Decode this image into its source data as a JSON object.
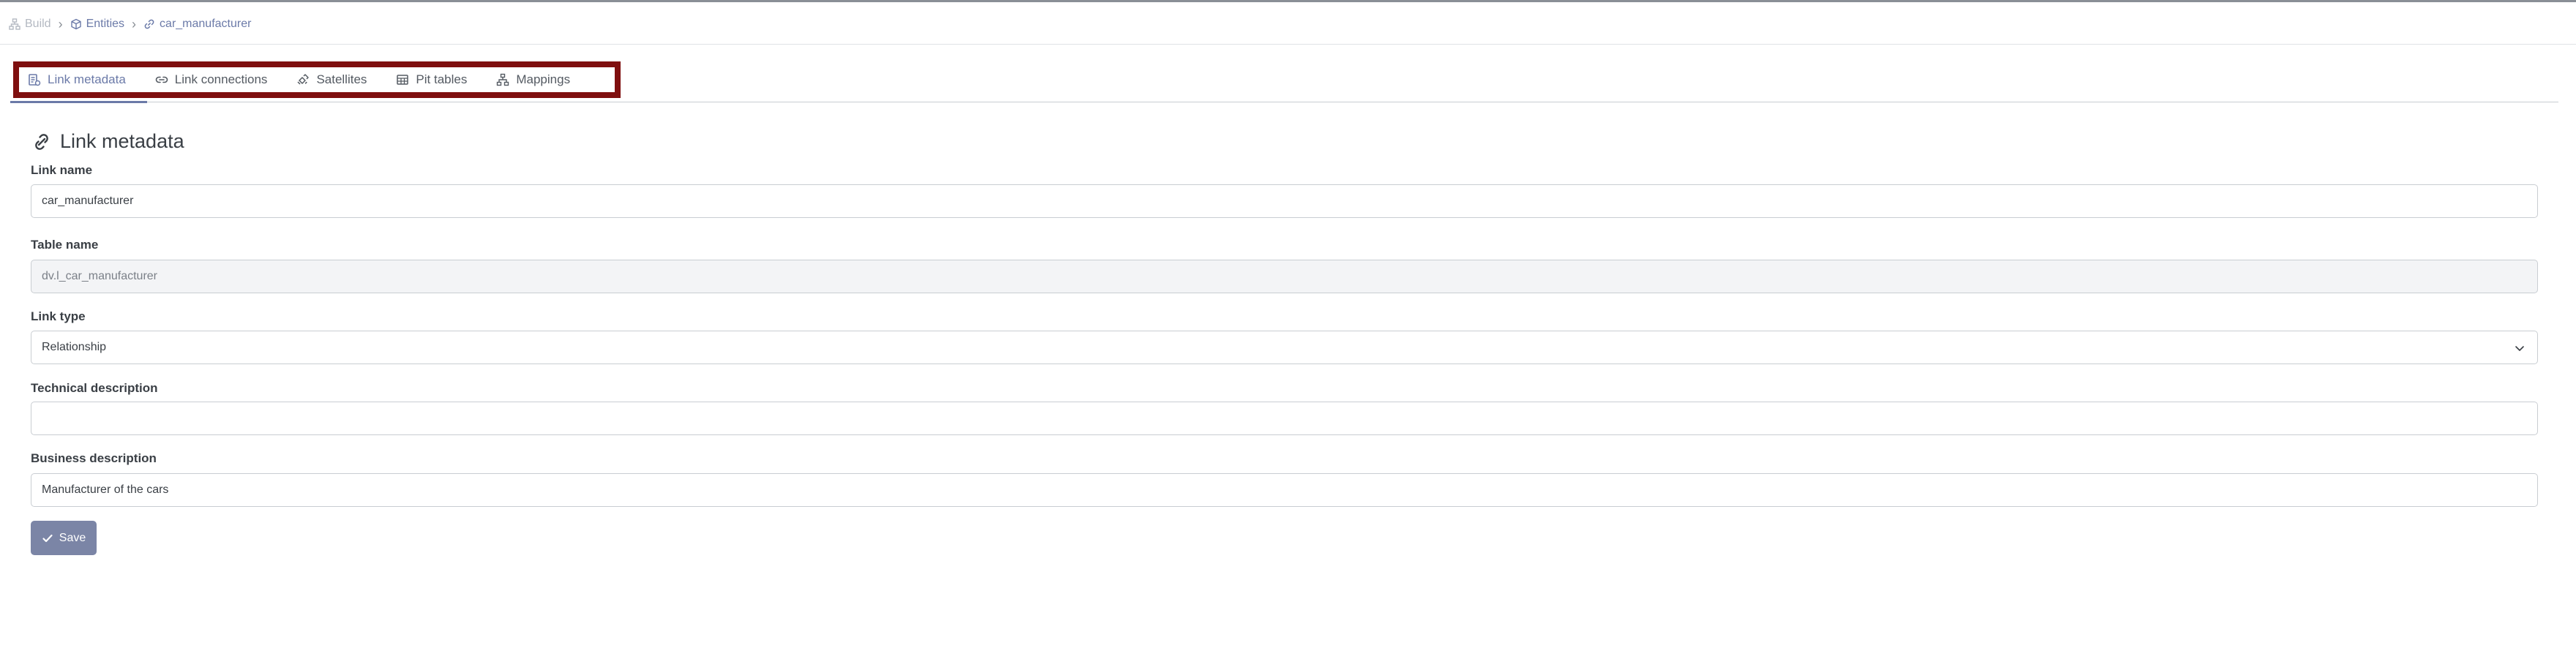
{
  "breadcrumb": {
    "items": [
      {
        "label": "Build",
        "icon": "sitemap-icon"
      },
      {
        "label": "Entities",
        "icon": "cube-icon"
      },
      {
        "label": "car_manufacturer",
        "icon": "link-icon"
      }
    ],
    "separator": "›"
  },
  "tabs": [
    {
      "label": "Link metadata",
      "icon": "metadata-icon",
      "active": true
    },
    {
      "label": "Link connections",
      "icon": "link-icon",
      "active": false
    },
    {
      "label": "Satellites",
      "icon": "satellite-icon",
      "active": false
    },
    {
      "label": "Pit tables",
      "icon": "table-icon",
      "active": false
    },
    {
      "label": "Mappings",
      "icon": "sitemap-icon",
      "active": false
    }
  ],
  "section": {
    "title": "Link metadata",
    "icon": "link-icon"
  },
  "form": {
    "link_name": {
      "label": "Link name",
      "value": "car_manufacturer"
    },
    "table_name": {
      "label": "Table name",
      "value": "dv.l_car_manufacturer",
      "disabled": true
    },
    "link_type": {
      "label": "Link type",
      "value": "Relationship"
    },
    "technical_description": {
      "label": "Technical description",
      "value": ""
    },
    "business_description": {
      "label": "Business description",
      "value": "Manufacturer of the cars"
    }
  },
  "save_button": {
    "label": "Save",
    "icon": "check-icon"
  },
  "colors": {
    "accent": "#6b7aa8",
    "highlight_border": "#7f0f0f",
    "button_bg": "#7b85a6",
    "disabled_field_bg": "#f3f4f6"
  }
}
